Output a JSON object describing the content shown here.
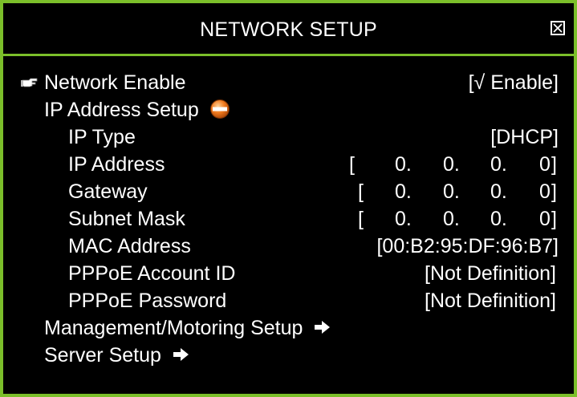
{
  "window": {
    "title": "NETWORK SETUP",
    "close_icon": "close-box-icon",
    "border_color": "#7bbf2a",
    "background": "#000000",
    "text_color": "#ffffff"
  },
  "menu": {
    "network_enable": {
      "label": "Network Enable",
      "value": "[√ Enable]",
      "pointer_icon": "hand-pointer-icon"
    },
    "ip_address_setup": {
      "label": "IP Address Setup",
      "icon": "collapse-minus-icon"
    },
    "ip_type": {
      "label": "IP Type",
      "value": "[DHCP]"
    },
    "ip_address": {
      "label": "IP Address",
      "open": "[",
      "octets": [
        "0.",
        "0.",
        "0.",
        "0"
      ],
      "close": "]"
    },
    "gateway": {
      "label": "Gateway",
      "open": "[",
      "octets": [
        "0.",
        "0.",
        "0.",
        "0"
      ],
      "close": "]"
    },
    "subnet_mask": {
      "label": "Subnet Mask",
      "open": "[",
      "octets": [
        "0.",
        "0.",
        "0.",
        "0"
      ],
      "close": "]"
    },
    "mac_address": {
      "label": "MAC Address",
      "value": "[00:B2:95:DF:96:B7]"
    },
    "pppoe_account_id": {
      "label": "PPPoE Account ID",
      "value": "[Not Definition]"
    },
    "pppoe_password": {
      "label": "PPPoE Password",
      "value": "[Not Definition]"
    },
    "management_setup": {
      "label": "Management/Motoring Setup",
      "icon": "arrow-right-icon"
    },
    "server_setup": {
      "label": "Server Setup",
      "icon": "arrow-right-icon"
    }
  }
}
